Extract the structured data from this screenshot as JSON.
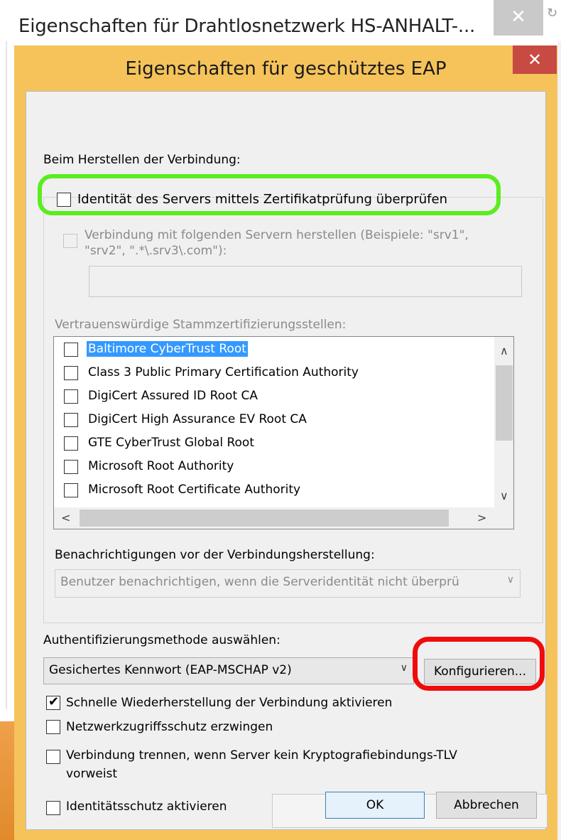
{
  "outer_window": {
    "title": "Eigenschaften für Drahtlosnetzwerk HS-ANHALT-...",
    "close_glyph": "✕"
  },
  "dialog": {
    "title": "Eigenschaften für geschütztes EAP",
    "close_glyph": "✕",
    "connect_section_label": "Beim Herstellen der Verbindung:",
    "verify_cert_label": "Identität des Servers mittels Zertifikatprüfung überprüfen",
    "verify_cert_checked": false,
    "connect_servers_label_line1": "Verbindung mit folgenden Servern herstellen (Beispiele: \"srv1\",",
    "connect_servers_label_line2": "\"srv2\", \".*\\.srv3\\.com\"):",
    "connect_servers_value": "",
    "trusted_ca_label": "Vertrauenswürdige Stammzertifizierungsstellen:",
    "certificates": [
      {
        "name": "Baltimore CyberTrust Root",
        "checked": false,
        "selected": true
      },
      {
        "name": "Class 3 Public Primary Certification Authority",
        "checked": false,
        "selected": false
      },
      {
        "name": "DigiCert Assured ID Root CA",
        "checked": false,
        "selected": false
      },
      {
        "name": "DigiCert High Assurance EV Root CA",
        "checked": false,
        "selected": false
      },
      {
        "name": "GTE CyberTrust Global Root",
        "checked": false,
        "selected": false
      },
      {
        "name": "Microsoft Root Authority",
        "checked": false,
        "selected": false
      },
      {
        "name": "Microsoft Root Certificate Authority",
        "checked": false,
        "selected": false
      }
    ],
    "notifications_label": "Benachrichtigungen vor der Verbindungsherstellung:",
    "notifications_value": "Benutzer benachrichtigen, wenn die Serveridentität nicht überprü",
    "auth_method_label": "Authentifizierungsmethode auswählen:",
    "auth_method_value": "Gesichertes Kennwort (EAP-MSCHAP v2)",
    "configure_button": "Konfigurieren...",
    "fast_reconnect_label": "Schnelle Wiederherstellung der Verbindung aktivieren",
    "fast_reconnect_checked": true,
    "nap_label": "Netzwerkzugriffsschutz erzwingen",
    "nap_checked": false,
    "disconnect_label_line1": "Verbindung trennen, wenn Server kein Kryptografiebindungs-TLV",
    "disconnect_label_line2": "vorweist",
    "disconnect_checked": false,
    "identity_privacy_label": "Identitätsschutz aktivieren",
    "identity_privacy_checked": false,
    "identity_privacy_value": "",
    "ok_button": "OK",
    "cancel_button": "Abbrechen"
  },
  "colors": {
    "dialog_frame": "#f5c35a",
    "close_button": "#c74b43",
    "selection": "#3399ff",
    "highlight_green": "#5bed1e",
    "highlight_red": "#f00c0c"
  },
  "icons": {
    "check": "✔",
    "chevron_down": "∨",
    "chevron_up": "∧",
    "chevron_left": "<",
    "chevron_right": ">"
  }
}
